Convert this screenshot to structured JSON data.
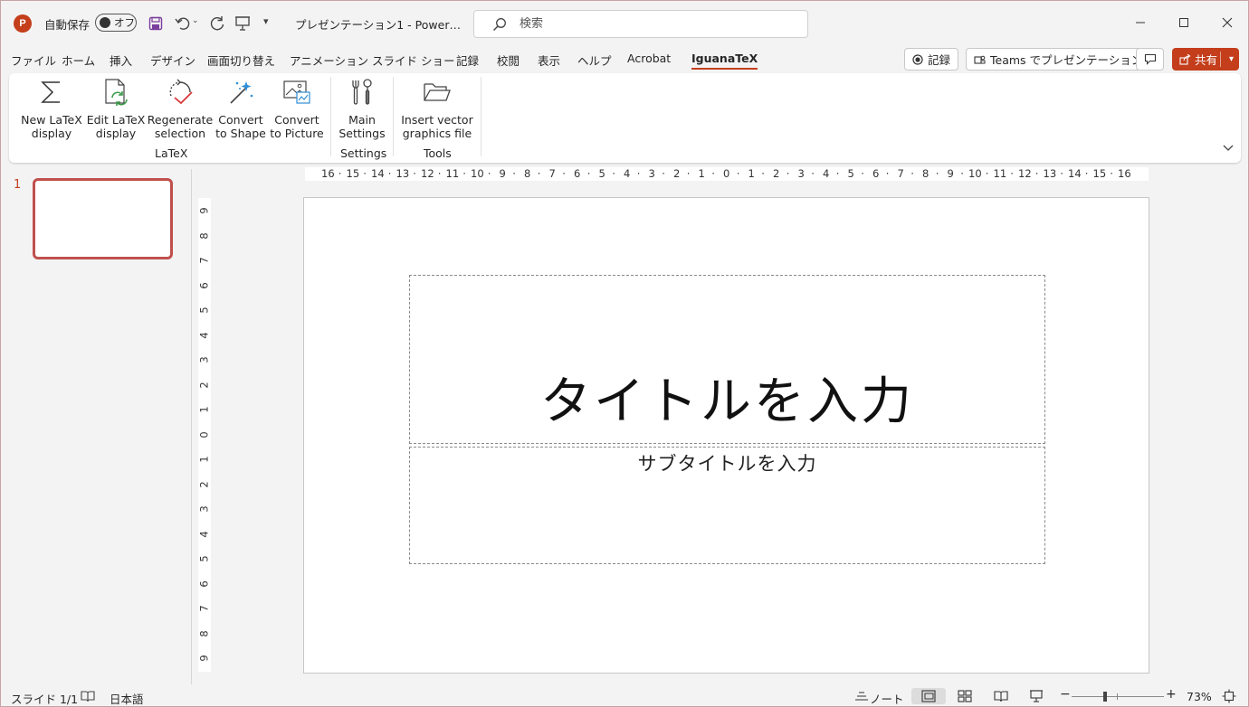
{
  "titlebar": {
    "app_icon_label": "P",
    "autosave_label": "自動保存",
    "autosave_toggle": "オフ",
    "doc_title": "プレゼンテーション1  -  Power…",
    "search_placeholder": "検索"
  },
  "tabs": [
    "ファイル",
    "ホーム",
    "挿入",
    "デザイン",
    "画面切り替え",
    "アニメーション",
    "スライド ショー",
    "記録",
    "校閲",
    "表示",
    "ヘルプ",
    "Acrobat",
    "IguanaTeX"
  ],
  "tab_actions": {
    "record": "記録",
    "teams": "Teams でプレゼンテーション",
    "share": "共有"
  },
  "ribbon": {
    "buttons": [
      {
        "label": "New LaTeX\ndisplay",
        "icon": "sigma-icon"
      },
      {
        "label": "Edit LaTeX\ndisplay",
        "icon": "edit-latex-icon"
      },
      {
        "label": "Regenerate\nselection",
        "icon": "regenerate-icon"
      },
      {
        "label": "Convert\nto Shape",
        "icon": "magic-wand-icon"
      },
      {
        "label": "Convert\nto Picture",
        "icon": "picture-icon"
      },
      {
        "label": "Main\nSettings",
        "icon": "tools-icon"
      },
      {
        "label": "Insert vector\ngraphics file",
        "icon": "folder-open-icon"
      }
    ],
    "groups": [
      "LaTeX",
      "Settings",
      "Tools"
    ]
  },
  "slides_pane": {
    "slide_number": "1"
  },
  "rulers": {
    "horizontal": [
      "16",
      "15",
      "14",
      "13",
      "12",
      "11",
      "10",
      "9",
      "8",
      "7",
      "6",
      "5",
      "4",
      "3",
      "2",
      "1",
      "0",
      "1",
      "2",
      "3",
      "4",
      "5",
      "6",
      "7",
      "8",
      "9",
      "10",
      "11",
      "12",
      "13",
      "14",
      "15",
      "16"
    ],
    "vertical": [
      "9",
      "8",
      "7",
      "6",
      "5",
      "4",
      "3",
      "2",
      "1",
      "0",
      "1",
      "2",
      "3",
      "4",
      "5",
      "6",
      "7",
      "8",
      "9"
    ]
  },
  "slide": {
    "title_placeholder": "タイトルを入力",
    "subtitle_placeholder": "サブタイトルを入力"
  },
  "statusbar": {
    "slide_count": "スライド 1/1",
    "language": "日本語",
    "notes": "ノート",
    "zoom": "73%"
  },
  "colors": {
    "accent": "#c43e1c",
    "thumb_border": "#c0504d"
  }
}
